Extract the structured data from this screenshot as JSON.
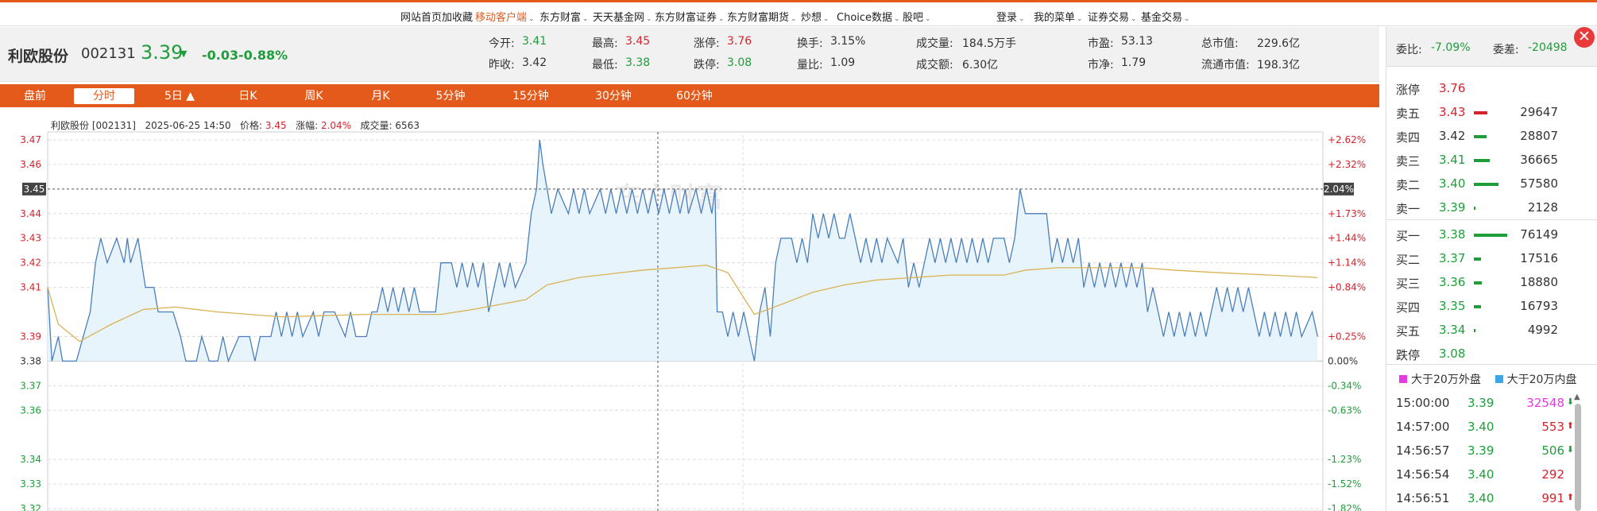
{
  "topnav": {
    "items": [
      {
        "label": "网站首页",
        "caret": false,
        "hl": false
      },
      {
        "label": "加收藏",
        "caret": false,
        "hl": false
      },
      {
        "label": "移动客户端",
        "caret": true,
        "hl": true
      },
      {
        "label": "东方财富",
        "caret": true,
        "hl": false
      },
      {
        "label": "天天基金网",
        "caret": true,
        "hl": false
      },
      {
        "label": "东方财富证券",
        "caret": true,
        "hl": false
      },
      {
        "label": "东方财富期货",
        "caret": true,
        "hl": false
      },
      {
        "label": "炒想",
        "caret": true,
        "hl": false
      },
      {
        "label": "Choice数据",
        "caret": true,
        "hl": false
      },
      {
        "label": "股吧",
        "caret": true,
        "hl": false
      }
    ],
    "right": [
      {
        "label": "登录",
        "caret": true
      },
      {
        "label": "我的菜单",
        "caret": true
      },
      {
        "label": "证券交易",
        "caret": true
      },
      {
        "label": "基金交易",
        "caret": true
      }
    ]
  },
  "quote": {
    "name": "利欧股份",
    "code": "002131",
    "price": "3.39",
    "arrow": "▼",
    "change": "-0.03",
    "pct": "-0.88%",
    "stats": [
      {
        "label": "今开:",
        "value": "3.41",
        "color": "green"
      },
      {
        "label": "昨收:",
        "value": "3.42",
        "color": "dark"
      },
      {
        "label": "最高:",
        "value": "3.45",
        "color": "red"
      },
      {
        "label": "最低:",
        "value": "3.38",
        "color": "green"
      },
      {
        "label": "涨停:",
        "value": "3.76",
        "color": "red"
      },
      {
        "label": "跌停:",
        "value": "3.08",
        "color": "green"
      },
      {
        "label": "换手:",
        "value": "3.15%",
        "color": "dark"
      },
      {
        "label": "量比:",
        "value": "1.09",
        "color": "dark"
      },
      {
        "label": "成交量:",
        "value": "184.5万手",
        "color": "dark"
      },
      {
        "label": "成交额:",
        "value": "6.30亿",
        "color": "dark"
      },
      {
        "label": "市盈:",
        "value": "53.13",
        "color": "dark"
      },
      {
        "label": "市净:",
        "value": "1.79",
        "color": "dark"
      },
      {
        "label": "总市值:",
        "value": "229.6亿",
        "color": "dark"
      },
      {
        "label": "流通市值:",
        "value": "198.3亿",
        "color": "dark"
      }
    ]
  },
  "tabs": [
    {
      "label": "盘前",
      "active": false
    },
    {
      "label": "分时",
      "active": true
    },
    {
      "label": "5日 ▲",
      "active": false
    },
    {
      "label": "日K",
      "active": false
    },
    {
      "label": "周K",
      "active": false
    },
    {
      "label": "月K",
      "active": false
    },
    {
      "label": "5分钟",
      "active": false
    },
    {
      "label": "15分钟",
      "active": false
    },
    {
      "label": "30分钟",
      "active": false
    },
    {
      "label": "60分钟",
      "active": false
    }
  ],
  "chart_header": {
    "stock": "利欧股份 [002131]",
    "date": "2025-06-25 14:50",
    "price_label": "价格:",
    "price": "3.45",
    "chg_label": "涨幅:",
    "chg": "2.04%",
    "vol_label": "成交量:",
    "vol": "6563"
  },
  "colors": {
    "accent": "#e45a1b",
    "up": "#d8222b",
    "down": "#1f9d3a",
    "price_line": "#4a7ebb",
    "avg_line": "#d9b255",
    "fill": "#e8f4fb"
  },
  "chart_data": {
    "type": "line",
    "watermark": "东方财富",
    "ylim": [
      3.315,
      3.475
    ],
    "prev_close": 3.38,
    "y_ticks_left": [
      "3.47",
      "3.46",
      "3.44",
      "3.43",
      "3.42",
      "3.41",
      "3.39",
      "3.38",
      "3.37",
      "3.36",
      "3.34",
      "3.33",
      "3.32"
    ],
    "y_ticks_right": [
      "+2.62%",
      "+2.32%",
      "+1.73%",
      "+1.44%",
      "+1.14%",
      "+0.84%",
      "+0.25%",
      "0.00%",
      "-0.34%",
      "-0.63%",
      "-1.23%",
      "-1.52%",
      "-1.82%"
    ],
    "crosshair": {
      "price_tag": "3.45",
      "pct_tag": "2.04%",
      "y": 3.45,
      "x": 0.478
    },
    "price": [
      [
        0,
        3.41
      ],
      [
        0.004,
        3.38
      ],
      [
        0.01,
        3.39
      ],
      [
        0.014,
        3.38
      ],
      [
        0.027,
        3.38
      ],
      [
        0.04,
        3.4
      ],
      [
        0.045,
        3.42
      ],
      [
        0.05,
        3.43
      ],
      [
        0.056,
        3.42
      ],
      [
        0.065,
        3.43
      ],
      [
        0.072,
        3.42
      ],
      [
        0.075,
        3.43
      ],
      [
        0.078,
        3.42
      ],
      [
        0.085,
        3.43
      ],
      [
        0.092,
        3.41
      ],
      [
        0.1,
        3.41
      ],
      [
        0.104,
        3.4
      ],
      [
        0.118,
        3.4
      ],
      [
        0.125,
        3.39
      ],
      [
        0.13,
        3.38
      ],
      [
        0.14,
        3.38
      ],
      [
        0.145,
        3.39
      ],
      [
        0.152,
        3.38
      ],
      [
        0.16,
        3.38
      ],
      [
        0.165,
        3.39
      ],
      [
        0.17,
        3.38
      ],
      [
        0.18,
        3.39
      ],
      [
        0.19,
        3.39
      ],
      [
        0.195,
        3.38
      ],
      [
        0.2,
        3.39
      ],
      [
        0.21,
        3.39
      ],
      [
        0.215,
        3.4
      ],
      [
        0.22,
        3.39
      ],
      [
        0.225,
        3.4
      ],
      [
        0.23,
        3.39
      ],
      [
        0.235,
        3.4
      ],
      [
        0.24,
        3.39
      ],
      [
        0.25,
        3.4
      ],
      [
        0.255,
        3.39
      ],
      [
        0.26,
        3.4
      ],
      [
        0.27,
        3.4
      ],
      [
        0.28,
        3.39
      ],
      [
        0.285,
        3.4
      ],
      [
        0.29,
        3.39
      ],
      [
        0.3,
        3.39
      ],
      [
        0.305,
        3.4
      ],
      [
        0.31,
        3.4
      ],
      [
        0.315,
        3.41
      ],
      [
        0.32,
        3.4
      ],
      [
        0.325,
        3.41
      ],
      [
        0.33,
        3.4
      ],
      [
        0.335,
        3.41
      ],
      [
        0.34,
        3.4
      ],
      [
        0.345,
        3.41
      ],
      [
        0.35,
        3.4
      ],
      [
        0.365,
        3.4
      ],
      [
        0.37,
        3.42
      ],
      [
        0.38,
        3.42
      ],
      [
        0.385,
        3.41
      ],
      [
        0.39,
        3.42
      ],
      [
        0.395,
        3.41
      ],
      [
        0.4,
        3.42
      ],
      [
        0.405,
        3.41
      ],
      [
        0.41,
        3.42
      ],
      [
        0.415,
        3.4
      ],
      [
        0.42,
        3.41
      ],
      [
        0.425,
        3.42
      ],
      [
        0.43,
        3.41
      ],
      [
        0.435,
        3.42
      ],
      [
        0.44,
        3.41
      ],
      [
        0.45,
        3.42
      ],
      [
        0.455,
        3.44
      ],
      [
        0.46,
        3.45
      ],
      [
        0.463,
        3.47
      ],
      [
        0.466,
        3.46
      ],
      [
        0.47,
        3.45
      ],
      [
        0.474,
        3.44
      ],
      [
        0.48,
        3.45
      ],
      [
        0.49,
        3.44
      ],
      [
        0.495,
        3.45
      ],
      [
        0.5,
        3.44
      ],
      [
        0.505,
        3.45
      ],
      [
        0.51,
        3.44
      ],
      [
        0.52,
        3.45
      ],
      [
        0.525,
        3.44
      ],
      [
        0.53,
        3.45
      ],
      [
        0.535,
        3.44
      ],
      [
        0.54,
        3.45
      ],
      [
        0.545,
        3.44
      ],
      [
        0.55,
        3.45
      ],
      [
        0.555,
        3.44
      ],
      [
        0.56,
        3.45
      ],
      [
        0.565,
        3.44
      ],
      [
        0.57,
        3.45
      ],
      [
        0.575,
        3.44
      ],
      [
        0.58,
        3.45
      ],
      [
        0.585,
        3.44
      ],
      [
        0.59,
        3.45
      ],
      [
        0.595,
        3.44
      ],
      [
        0.6,
        3.45
      ],
      [
        0.603,
        3.44
      ],
      [
        0.61,
        3.45
      ],
      [
        0.615,
        3.44
      ],
      [
        0.62,
        3.45
      ],
      [
        0.625,
        3.44
      ],
      [
        0.628,
        3.45
      ],
      [
        0.63,
        3.4
      ],
      [
        0.635,
        3.4
      ],
      [
        0.64,
        3.39
      ],
      [
        0.645,
        3.4
      ],
      [
        0.65,
        3.39
      ],
      [
        0.655,
        3.4
      ],
      [
        0.66,
        3.39
      ],
      [
        0.665,
        3.38
      ],
      [
        0.67,
        3.4
      ],
      [
        0.675,
        3.41
      ],
      [
        0.68,
        3.39
      ],
      [
        0.685,
        3.42
      ],
      [
        0.69,
        3.43
      ],
      [
        0.7,
        3.43
      ],
      [
        0.705,
        3.42
      ],
      [
        0.71,
        3.43
      ],
      [
        0.715,
        3.42
      ],
      [
        0.72,
        3.44
      ],
      [
        0.725,
        3.43
      ],
      [
        0.73,
        3.44
      ],
      [
        0.735,
        3.43
      ],
      [
        0.74,
        3.44
      ],
      [
        0.745,
        3.43
      ],
      [
        0.75,
        3.43
      ],
      [
        0.755,
        3.44
      ],
      [
        0.76,
        3.43
      ],
      [
        0.765,
        3.42
      ],
      [
        0.77,
        3.43
      ],
      [
        0.775,
        3.42
      ],
      [
        0.78,
        3.43
      ],
      [
        0.785,
        3.42
      ],
      [
        0.79,
        3.43
      ],
      [
        0.8,
        3.42
      ],
      [
        0.805,
        3.43
      ],
      [
        0.81,
        3.41
      ],
      [
        0.815,
        3.42
      ],
      [
        0.82,
        3.41
      ],
      [
        0.825,
        3.42
      ],
      [
        0.83,
        3.43
      ],
      [
        0.835,
        3.42
      ],
      [
        0.84,
        3.43
      ],
      [
        0.845,
        3.42
      ],
      [
        0.85,
        3.43
      ],
      [
        0.855,
        3.42
      ],
      [
        0.86,
        3.43
      ],
      [
        0.865,
        3.42
      ],
      [
        0.87,
        3.43
      ],
      [
        0.875,
        3.42
      ],
      [
        0.88,
        3.43
      ],
      [
        0.885,
        3.42
      ],
      [
        0.89,
        3.43
      ],
      [
        0.9,
        3.43
      ],
      [
        0.905,
        3.42
      ],
      [
        0.91,
        3.43
      ],
      [
        0.915,
        3.45
      ],
      [
        0.92,
        3.44
      ],
      [
        0.925,
        3.44
      ],
      [
        0.94,
        3.44
      ],
      [
        0.945,
        3.42
      ],
      [
        0.95,
        3.43
      ],
      [
        0.955,
        3.42
      ],
      [
        0.96,
        3.43
      ],
      [
        0.965,
        3.42
      ],
      [
        0.97,
        3.43
      ],
      [
        0.975,
        3.41
      ],
      [
        0.98,
        3.42
      ],
      [
        0.985,
        3.41
      ],
      [
        0.99,
        3.42
      ],
      [
        0.995,
        3.41
      ],
      [
        1.0,
        3.42
      ],
      [
        1.005,
        3.41
      ],
      [
        1.01,
        3.42
      ],
      [
        1.015,
        3.41
      ],
      [
        1.02,
        3.42
      ],
      [
        1.025,
        3.41
      ],
      [
        1.03,
        3.42
      ],
      [
        1.035,
        3.4
      ],
      [
        1.04,
        3.41
      ],
      [
        1.045,
        3.4
      ],
      [
        1.05,
        3.39
      ],
      [
        1.055,
        3.4
      ],
      [
        1.06,
        3.39
      ],
      [
        1.065,
        3.4
      ],
      [
        1.07,
        3.39
      ],
      [
        1.075,
        3.4
      ],
      [
        1.08,
        3.39
      ],
      [
        1.085,
        3.4
      ],
      [
        1.09,
        3.39
      ],
      [
        1.095,
        3.4
      ],
      [
        1.1,
        3.41
      ],
      [
        1.105,
        3.4
      ],
      [
        1.11,
        3.41
      ],
      [
        1.115,
        3.4
      ],
      [
        1.12,
        3.41
      ],
      [
        1.125,
        3.4
      ],
      [
        1.13,
        3.41
      ],
      [
        1.135,
        3.4
      ],
      [
        1.14,
        3.39
      ],
      [
        1.145,
        3.4
      ],
      [
        1.15,
        3.39
      ],
      [
        1.155,
        3.4
      ],
      [
        1.16,
        3.39
      ],
      [
        1.165,
        3.4
      ],
      [
        1.17,
        3.39
      ],
      [
        1.175,
        3.4
      ],
      [
        1.18,
        3.39
      ],
      [
        1.19,
        3.4
      ],
      [
        1.195,
        3.39
      ]
    ],
    "avg": [
      [
        0,
        3.41
      ],
      [
        0.01,
        3.395
      ],
      [
        0.03,
        3.388
      ],
      [
        0.06,
        3.395
      ],
      [
        0.09,
        3.401
      ],
      [
        0.12,
        3.402
      ],
      [
        0.16,
        3.4
      ],
      [
        0.22,
        3.398
      ],
      [
        0.3,
        3.399
      ],
      [
        0.37,
        3.399
      ],
      [
        0.4,
        3.401
      ],
      [
        0.45,
        3.405
      ],
      [
        0.47,
        3.411
      ],
      [
        0.5,
        3.414
      ],
      [
        0.56,
        3.417
      ],
      [
        0.62,
        3.419
      ],
      [
        0.64,
        3.416
      ],
      [
        0.665,
        3.399
      ],
      [
        0.69,
        3.403
      ],
      [
        0.72,
        3.408
      ],
      [
        0.75,
        3.411
      ],
      [
        0.78,
        3.413
      ],
      [
        0.85,
        3.415
      ],
      [
        0.9,
        3.415
      ],
      [
        0.92,
        3.417
      ],
      [
        0.95,
        3.418
      ],
      [
        1.0,
        3.418
      ],
      [
        1.03,
        3.418
      ],
      [
        1.06,
        3.417
      ],
      [
        1.1,
        3.416
      ],
      [
        1.15,
        3.415
      ],
      [
        1.195,
        3.414
      ]
    ]
  },
  "side": {
    "webi_label": "委比:",
    "webi": "-7.09%",
    "weicha_label": "委差:",
    "weicha": "-20498",
    "zhangting": {
      "label": "涨停",
      "price": "3.76"
    },
    "asks": [
      {
        "label": "卖五",
        "price": "3.43",
        "vol": "29647",
        "color": "red",
        "bar": 0.32,
        "barcolor": "r"
      },
      {
        "label": "卖四",
        "price": "3.42",
        "vol": "28807",
        "color": "dark",
        "bar": 0.3,
        "barcolor": "g"
      },
      {
        "label": "卖三",
        "price": "3.41",
        "vol": "36665",
        "color": "green",
        "bar": 0.38,
        "barcolor": "g"
      },
      {
        "label": "卖二",
        "price": "3.40",
        "vol": "57580",
        "color": "green",
        "bar": 0.6,
        "barcolor": "g"
      },
      {
        "label": "卖一",
        "price": "3.39",
        "vol": "2128",
        "color": "green",
        "bar": 0.02,
        "barcolor": "g"
      }
    ],
    "bids": [
      {
        "label": "买一",
        "price": "3.38",
        "vol": "76149",
        "color": "green",
        "bar": 0.8,
        "barcolor": "g"
      },
      {
        "label": "买二",
        "price": "3.37",
        "vol": "17516",
        "color": "green",
        "bar": 0.18,
        "barcolor": "g"
      },
      {
        "label": "买三",
        "price": "3.36",
        "vol": "18880",
        "color": "green",
        "bar": 0.2,
        "barcolor": "g"
      },
      {
        "label": "买四",
        "price": "3.35",
        "vol": "16793",
        "color": "green",
        "bar": 0.17,
        "barcolor": "g"
      },
      {
        "label": "买五",
        "price": "3.34",
        "vol": "4992",
        "color": "green",
        "bar": 0.03,
        "barcolor": "g"
      }
    ],
    "dieting": {
      "label": "跌停",
      "price": "3.08"
    },
    "legend_buy": "大于20万外盘",
    "legend_sell": "大于20万内盘",
    "buy_color": "#e23be0",
    "sell_color": "#3aa8e8",
    "trades": [
      {
        "time": "15:00:00",
        "price": "3.39",
        "pcolor": "green",
        "vol": "32548",
        "vcolor": "magenta",
        "arrow": "⬇",
        "acolor": "green"
      },
      {
        "time": "14:57:00",
        "price": "3.40",
        "pcolor": "green",
        "vol": "553",
        "vcolor": "red",
        "arrow": "⬆",
        "acolor": "red"
      },
      {
        "time": "14:56:57",
        "price": "3.39",
        "pcolor": "green",
        "vol": "506",
        "vcolor": "green",
        "arrow": "⬇",
        "acolor": "green"
      },
      {
        "time": "14:56:54",
        "price": "3.40",
        "pcolor": "green",
        "vol": "292",
        "vcolor": "red",
        "arrow": "",
        "acolor": "red"
      },
      {
        "time": "14:56:51",
        "price": "3.40",
        "pcolor": "green",
        "vol": "991",
        "vcolor": "red",
        "arrow": "⬆",
        "acolor": "red"
      }
    ],
    "close_glyph": "✕"
  }
}
